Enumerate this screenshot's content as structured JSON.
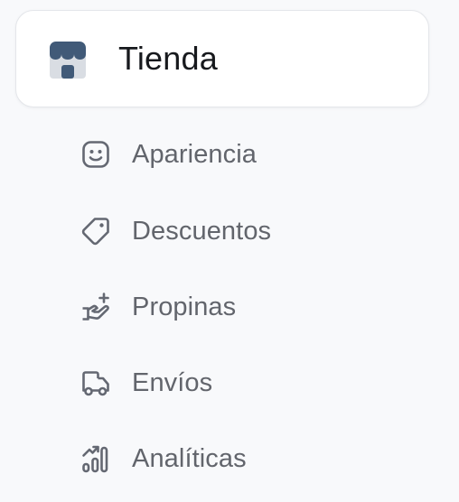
{
  "store": {
    "icon": "store-icon",
    "title": "Tienda"
  },
  "nav": {
    "items": [
      {
        "icon": "smile-icon",
        "label": "Apariencia"
      },
      {
        "icon": "tag-icon",
        "label": "Descuentos"
      },
      {
        "icon": "hand-plus-icon",
        "label": "Propinas"
      },
      {
        "icon": "truck-icon",
        "label": "Envíos"
      },
      {
        "icon": "analytics-icon",
        "label": "Analíticas"
      }
    ]
  },
  "colors": {
    "background": "#f8f9fb",
    "card": "#ffffff",
    "title": "#17191d",
    "label": "#62656c",
    "icon": "#646872",
    "storeIcon": "#415a78"
  }
}
